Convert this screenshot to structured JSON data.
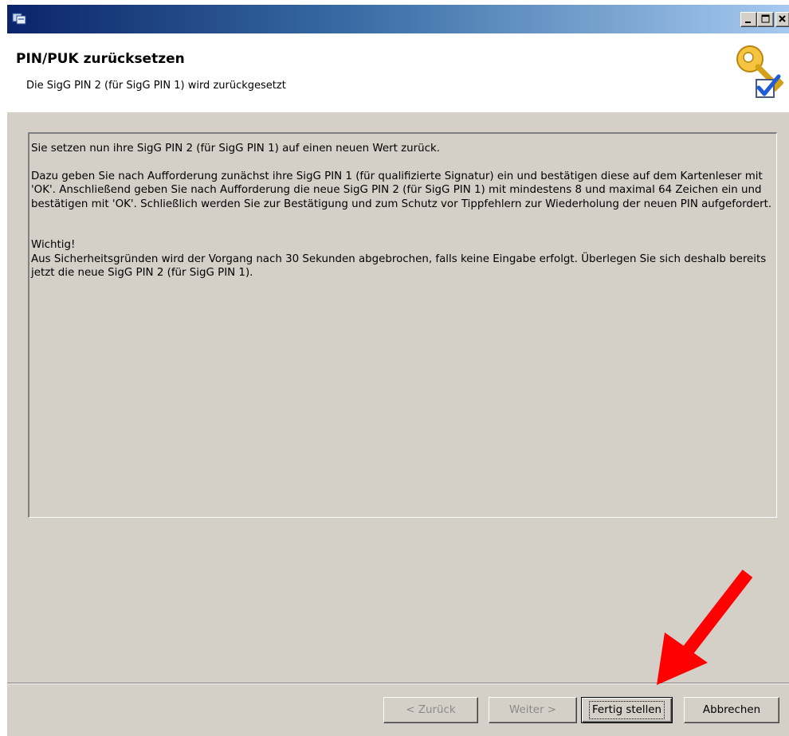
{
  "window": {
    "controls": [
      "minimize-icon",
      "maximize-icon",
      "close-icon"
    ]
  },
  "header": {
    "title": "PIN/PUK zurücksetzen",
    "subtitle": "Die SigG PIN 2 (für SigG PIN 1) wird zurückgesetzt",
    "icon": "key-check-icon"
  },
  "content": {
    "paragraph1": "Sie setzen nun ihre SigG PIN 2 (für SigG PIN 1) auf einen neuen Wert zurück.",
    "paragraph2": "Dazu geben Sie nach Aufforderung zunächst ihre SigG PIN 1 (für qualifizierte Signatur) ein und bestätigen diese auf dem Kartenleser mit 'OK'. Anschließend geben Sie nach Aufforderung die neue SigG PIN 2 (für SigG PIN 1) mit mindestens 8 und maximal 64 Zeichen ein und bestätigen mit 'OK'. Schließlich werden Sie zur Bestätigung und zum Schutz vor Tippfehlern zur Wiederholung der neuen PIN aufgefordert.",
    "important_heading": "Wichtig!",
    "important_text": "Aus Sicherheitsgründen wird der Vorgang nach 30 Sekunden abgebrochen, falls keine Eingabe erfolgt. Überlegen Sie sich deshalb bereits jetzt die neue SigG PIN 2 (für SigG PIN 1)."
  },
  "buttons": {
    "back": "< Zurück",
    "next": "Weiter >",
    "finish": "Fertig stellen",
    "cancel": "Abbrechen"
  },
  "annotation": {
    "arrow_color": "#ff0000"
  }
}
